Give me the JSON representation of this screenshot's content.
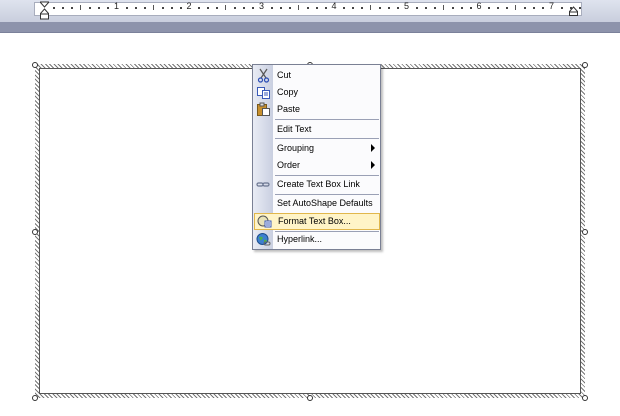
{
  "ruler": {
    "numbers": [
      "1",
      "2",
      "3",
      "4",
      "5",
      "6",
      "7"
    ]
  },
  "context_menu": {
    "items": [
      {
        "label": "Cut",
        "icon": "scissors-icon"
      },
      {
        "label": "Copy",
        "icon": "copy-icon"
      },
      {
        "label": "Paste",
        "icon": "paste-icon"
      },
      {
        "label": "Edit Text",
        "icon": ""
      },
      {
        "label": "Grouping",
        "icon": "",
        "submenu": true
      },
      {
        "label": "Order",
        "icon": "",
        "submenu": true
      },
      {
        "label": "Create Text Box Link",
        "icon": "link-icon"
      },
      {
        "label": "Set AutoShape Defaults",
        "icon": ""
      },
      {
        "label": "Format Text Box...",
        "icon": "format-textbox-icon",
        "highlighted": true
      },
      {
        "label": "Hyperlink...",
        "icon": "hyperlink-globe-icon"
      }
    ]
  },
  "colors": {
    "highlight_fill": "#fff4c7",
    "highlight_border": "#e1b74c",
    "menu_gutter": "#d9deeb"
  }
}
